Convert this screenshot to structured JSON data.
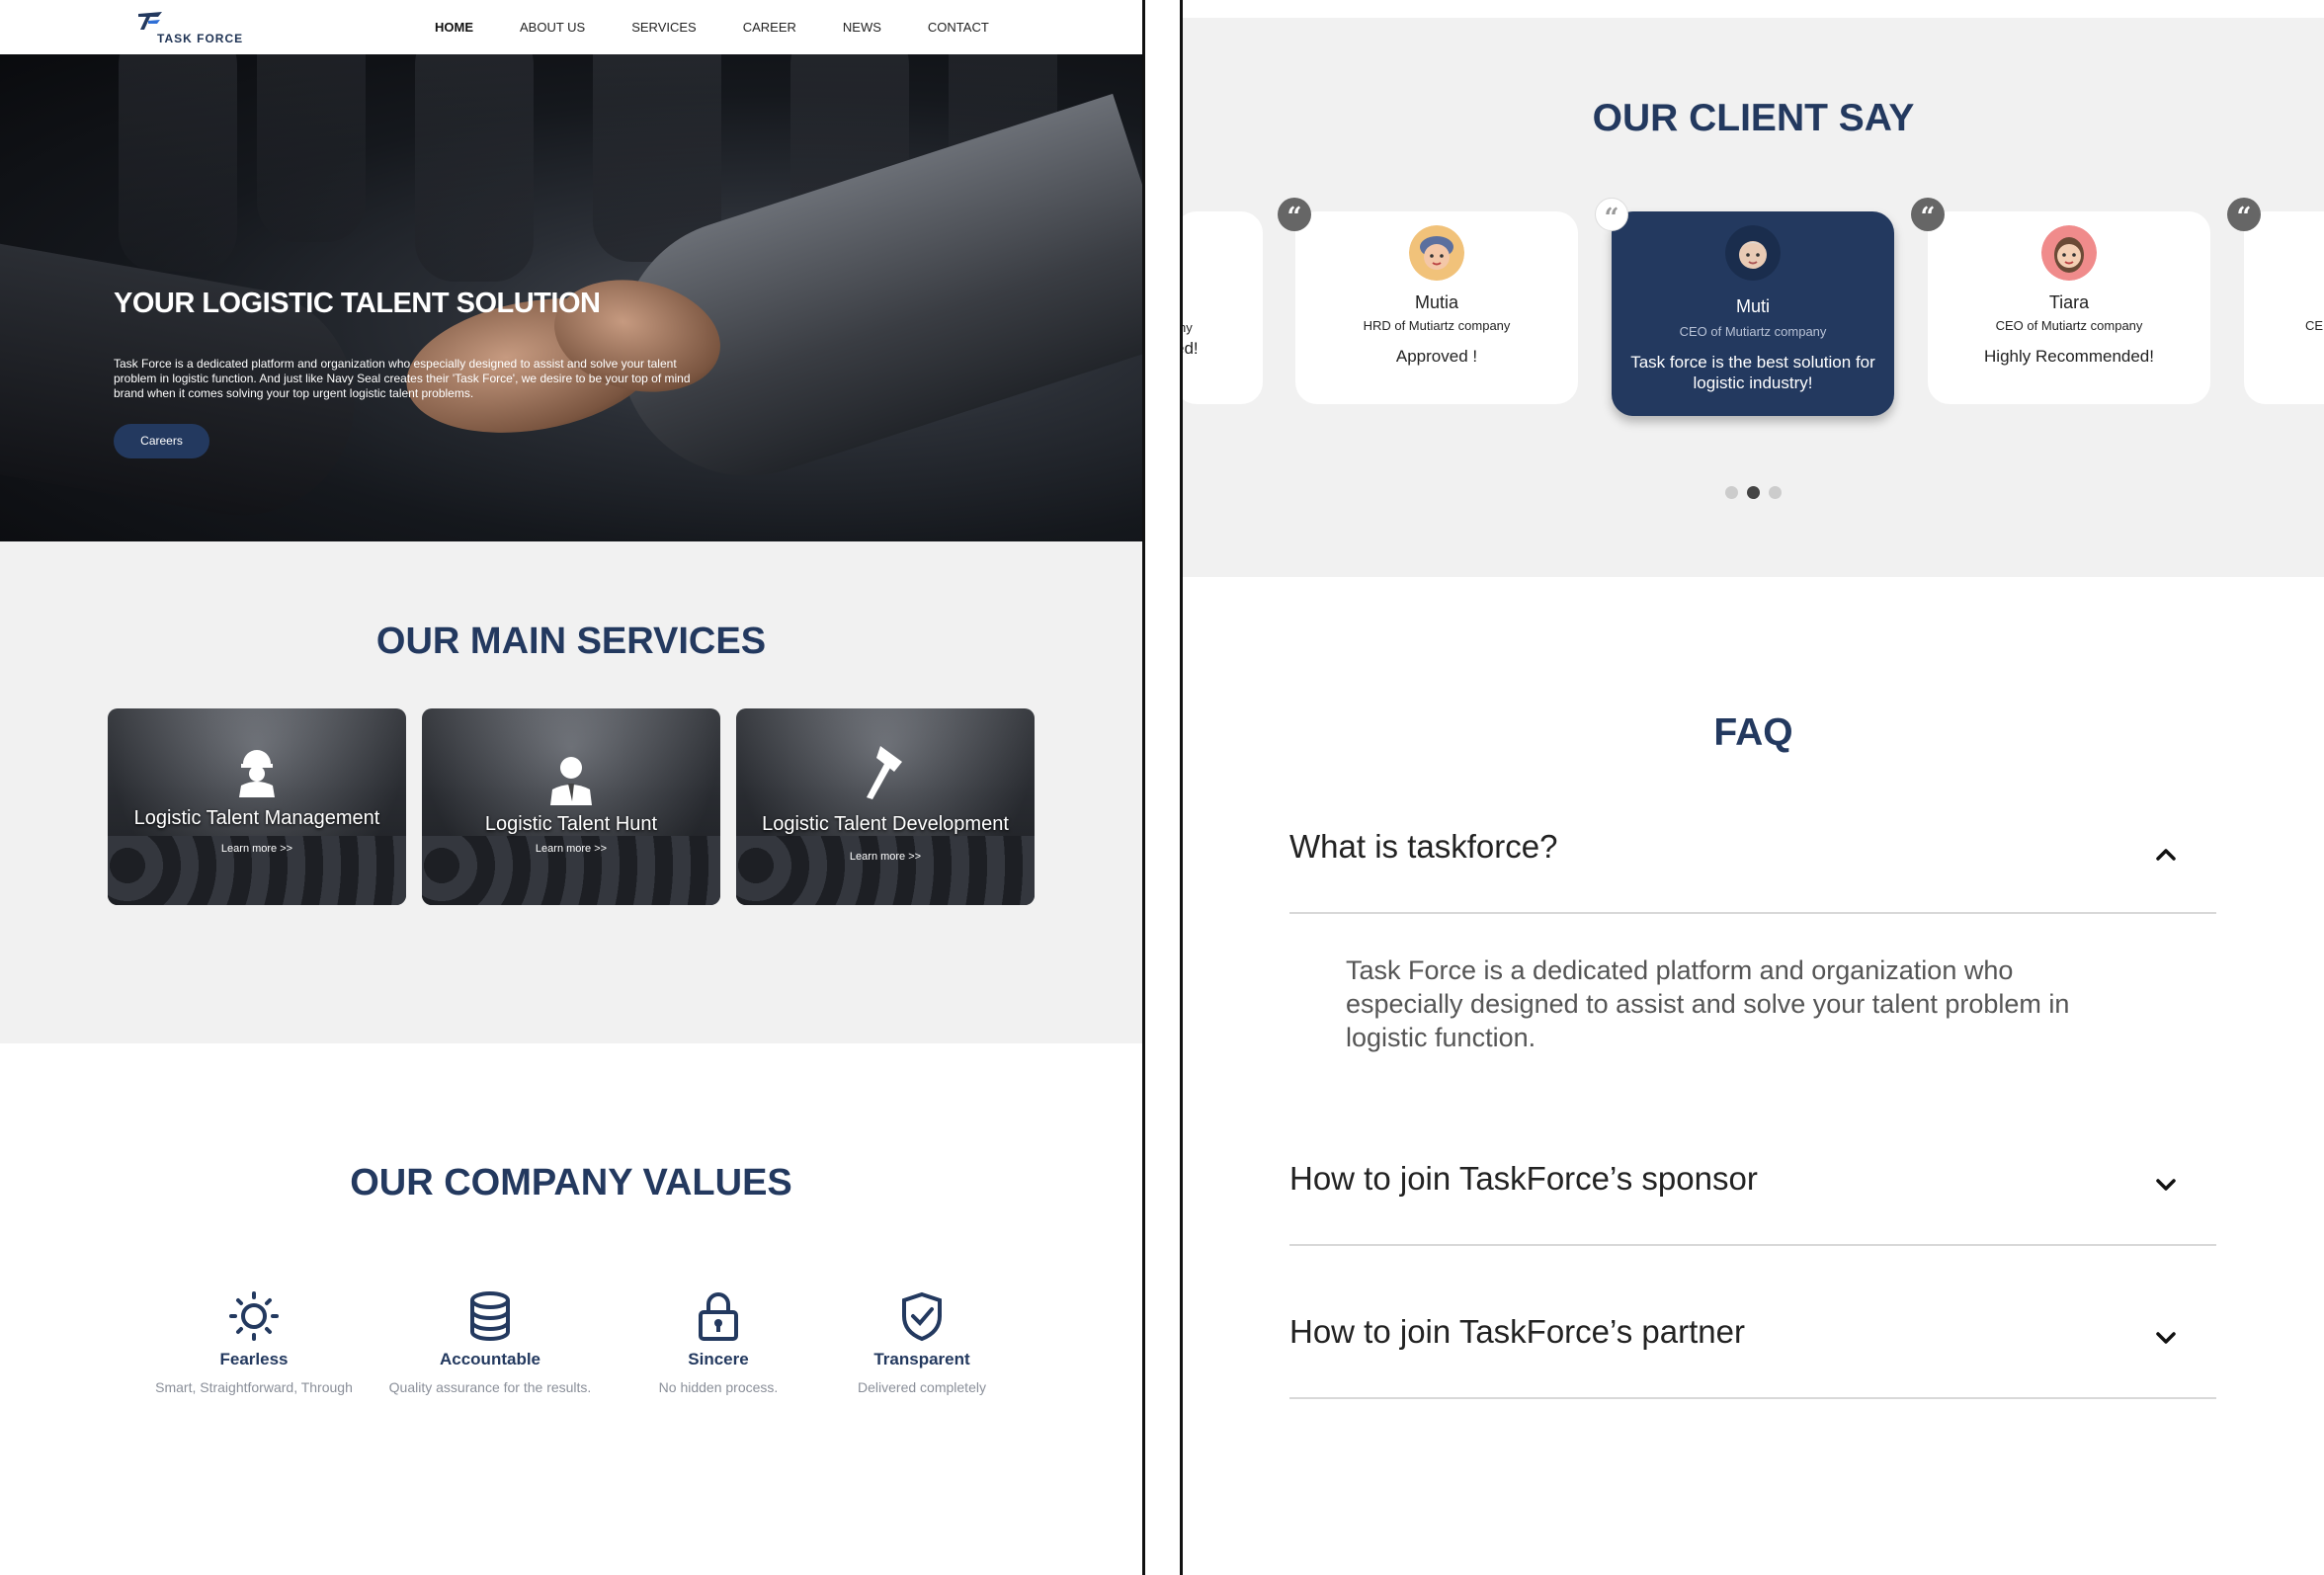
{
  "nav": {
    "logo_text": "TASK FORCE",
    "items": [
      "HOME",
      "ABOUT US",
      "SERVICES",
      "CAREER",
      "NEWS",
      "CONTACT"
    ],
    "active": "HOME"
  },
  "hero": {
    "title": "YOUR LOGISTIC TALENT SOLUTION",
    "description": "Task Force is a dedicated platform and organization who especially designed to assist and solve your talent problem in logistic function. And just like Navy Seal creates their 'Task Force', we desire to be your top  of mind brand when it comes solving your top urgent logistic talent problems.",
    "button": "Careers"
  },
  "services": {
    "title": "OUR MAIN SERVICES",
    "cards": [
      {
        "name": "Logistic Talent Management",
        "link": "Learn more >>",
        "icon": "worker-helmet-icon"
      },
      {
        "name": "Logistic Talent Hunt",
        "link": "Learn more >>",
        "icon": "businessman-icon"
      },
      {
        "name": "Logistic Talent Development",
        "link": "Learn more >>",
        "icon": "axe-icon"
      }
    ]
  },
  "values": {
    "title": "OUR COMPANY VALUES",
    "items": [
      {
        "name": "Fearless",
        "desc": "Smart, Straightforward, Through",
        "icon": "sun-icon"
      },
      {
        "name": "Accountable",
        "desc": "Quality assurance for the results.",
        "icon": "database-icon"
      },
      {
        "name": "Sincere",
        "desc": "No hidden process.",
        "icon": "lock-icon"
      },
      {
        "name": "Transparent",
        "desc": "Delivered completely",
        "icon": "shield-check-icon"
      }
    ]
  },
  "clients": {
    "title": "OUR CLIENT SAY",
    "partial_left": {
      "role_fragment": "ny",
      "text_fragment": "ed!"
    },
    "partial_right": {
      "role_fragment": "CE"
    },
    "cards": [
      {
        "name": "Mutia",
        "role": "HRD of Mutiartz company",
        "text": "Approved !"
      },
      {
        "name": "Muti",
        "role": "CEO of Mutiartz company",
        "text": "Task force is the best solution for logistic industry!"
      },
      {
        "name": "Tiara",
        "role": "CEO of Mutiartz company",
        "text": "Highly Recommended!"
      }
    ],
    "active_index": 1,
    "pagination_count": 3,
    "pagination_active": 2
  },
  "faq": {
    "title": "FAQ",
    "items": [
      {
        "question": "What is taskforce?",
        "answer": "Task Force is a dedicated platform and organization who especially designed to assist and solve your talent problem in logistic function.",
        "expanded": true
      },
      {
        "question": "How to join TaskForce’s sponsor",
        "expanded": false
      },
      {
        "question": "How to join TaskForce’s partner",
        "expanded": false
      }
    ]
  },
  "colors": {
    "navy": "#23395f",
    "panel_gray": "#f1f1f1"
  }
}
